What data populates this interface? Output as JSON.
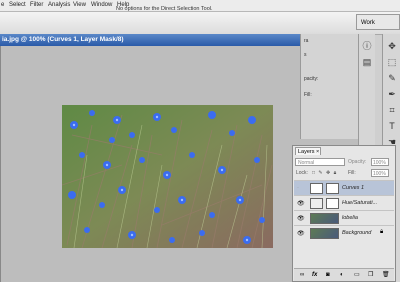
{
  "menubar": {
    "items": [
      "e",
      "Select",
      "Filter",
      "Analysis",
      "View",
      "Window",
      "Help"
    ]
  },
  "options_bar": {
    "message": "No options for the Direct Selection Tool.",
    "workspace_label": "Work"
  },
  "document": {
    "title": "ia.jpg @ 100% (Curves 1, Layer Mask/8)"
  },
  "info_panel": {
    "labels": [
      "ra",
      "s",
      "pacity:",
      "Fill:"
    ]
  },
  "layers_panel": {
    "tab_label": "Layers",
    "tab_close": "×",
    "blend_mode": "Normal",
    "opacity_label": "Opacity:",
    "opacity_value": "100%",
    "lock_label": "Lock:",
    "fill_label": "Fill:",
    "fill_value": "100%",
    "layers": [
      {
        "name": "Curves 1",
        "selected": true
      },
      {
        "name": "Hue/Saturati...",
        "selected": false
      },
      {
        "name": "lobelia",
        "selected": false
      },
      {
        "name": "Background",
        "selected": false
      }
    ],
    "bottom_icons": [
      "link-icon",
      "fx-icon",
      "mask-icon",
      "adjustment-icon",
      "group-icon",
      "new-layer-icon",
      "trash-icon"
    ]
  },
  "colors": {
    "title_bar": "#2a5aa8",
    "selected_layer": "#b8c4d8",
    "canvas_bg": "#bdbdbd"
  }
}
